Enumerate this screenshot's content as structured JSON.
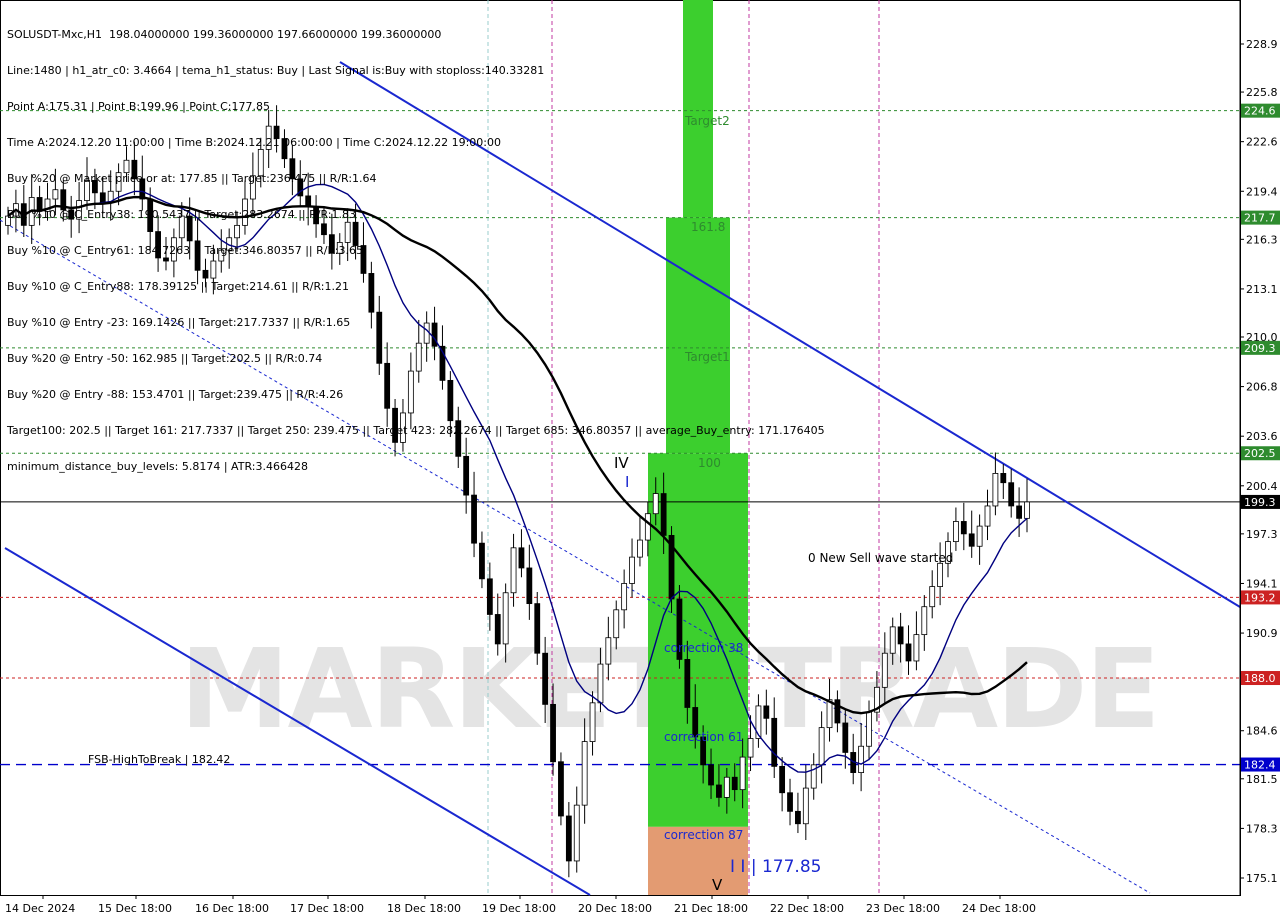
{
  "header": {
    "lines": [
      "SOLUSDT-Mxc,H1  198.04000000 199.36000000 197.66000000 199.36000000",
      "Line:1480 | h1_atr_c0: 3.4664 | tema_h1_status: Buy | Last Signal is:Buy with stoploss:140.33281",
      "Point A:175.31 | Point B:199.96 | Point C:177.85",
      "Time A:2024.12.20 11:00:00 | Time B:2024.12.21 06:00:00 | Time C:2024.12.22 19:00:00",
      "Buy %20 @ Market price or at: 177.85 || Target:236.475 || R/R:1.64",
      "Buy %10 @ C_Entry38: 190.5437 || Target:283.2674 || R/R:1.83",
      "Buy %10 @ C_Entry61: 184.7263 || Target:346.80357 || R/R:3.65",
      "Buy %10 @ C_Entry88: 178.39125 || Target:214.61 || R/R:1.21",
      "Buy %10 @ Entry -23: 169.1426 || Target:217.7337 || R/R:1.65",
      "Buy %20 @ Entry -50: 162.985 || Target:202.5 || R/R:0.74",
      "Buy %20 @ Entry -88: 153.4701 || Target:239.475 || R/R:4.26",
      "Target100: 202.5 || Target 161: 217.7337 || Target 250: 239.475 || Target 423: 282.2674 || Target 685: 346.80357 || average_Buy_entry: 171.176405",
      "minimum_distance_buy_levels: 5.8174 | ATR:3.466428"
    ]
  },
  "chart_data": {
    "type": "candlestick",
    "symbol": "SOLUSDT-Mxc",
    "timeframe": "H1",
    "ohlc_last": {
      "open": 198.04,
      "high": 199.36,
      "low": 197.66,
      "close": 199.36
    },
    "ylim": [
      174.0,
      230.5
    ],
    "y_ticks": [
      228.9,
      225.8,
      222.6,
      219.4,
      216.3,
      213.1,
      210.0,
      206.8,
      203.6,
      200.4,
      197.3,
      194.1,
      190.9,
      187.8,
      184.6,
      181.5,
      178.3,
      175.1
    ],
    "x_labels": [
      "14 Dec 2024",
      "15 Dec 18:00",
      "16 Dec 18:00",
      "17 Dec 18:00",
      "18 Dec 18:00",
      "19 Dec 18:00",
      "20 Dec 18:00",
      "21 Dec 18:00",
      "22 Dec 18:00",
      "23 Dec 18:00",
      "24 Dec 18:00"
    ],
    "price_levels": [
      {
        "value": 224.6,
        "label": "224.6",
        "color": "#2e8b2e",
        "style": "dotted"
      },
      {
        "value": 217.7,
        "label": "217.7",
        "color": "#2e8b2e",
        "style": "dotted"
      },
      {
        "value": 209.3,
        "label": "209.3",
        "color": "#2e8b2e",
        "style": "dotted"
      },
      {
        "value": 202.5,
        "label": "202.5",
        "color": "#2e8b2e",
        "style": "dotted"
      },
      {
        "value": 199.36,
        "label": "199.3",
        "color": "#000000",
        "style": "solid"
      },
      {
        "value": 193.2,
        "label": "193.2",
        "color": "#cc2222",
        "style": "dotted"
      },
      {
        "value": 188.0,
        "label": "188.0",
        "color": "#cc2222",
        "style": "dotted"
      },
      {
        "value": 182.42,
        "label": "182.4",
        "color": "#0000cc",
        "style": "dashed"
      }
    ],
    "zone_labels": [
      "Target2",
      "161.8",
      "Target1",
      "100",
      "correction 38",
      "correction 61",
      "correction 87"
    ],
    "annotations": {
      "wave_iv": "IV",
      "wave_i": "I",
      "wave_v": "V",
      "wave_ii": "I I | 177.85",
      "new_sell_wave": "0 New Sell wave started",
      "fsb_label": "FSB-HighToBreak | 182.42"
    },
    "candles_close": [
      217.8,
      218.6,
      217.2,
      219.0,
      218.1,
      218.9,
      219.5,
      218.2,
      217.6,
      218.8,
      220.1,
      219.3,
      218.7,
      219.4,
      220.6,
      221.4,
      220.2,
      218.9,
      216.8,
      215.1,
      214.9,
      216.4,
      217.8,
      216.2,
      214.3,
      213.8,
      214.9,
      215.6,
      216.4,
      217.2,
      218.9,
      220.4,
      222.1,
      223.6,
      222.8,
      221.5,
      220.2,
      219.1,
      218.4,
      217.3,
      216.6,
      215.4,
      216.1,
      217.4,
      215.9,
      214.1,
      211.6,
      208.3,
      205.4,
      203.2,
      205.1,
      207.8,
      209.6,
      210.9,
      209.4,
      207.2,
      204.6,
      202.3,
      199.8,
      196.7,
      194.4,
      192.1,
      190.2,
      193.5,
      196.4,
      195.1,
      192.8,
      189.6,
      186.3,
      182.6,
      179.1,
      176.2,
      179.8,
      183.9,
      186.4,
      188.9,
      190.6,
      192.4,
      194.1,
      195.8,
      196.9,
      198.6,
      199.9,
      197.2,
      193.1,
      189.2,
      186.1,
      184.2,
      182.4,
      181.1,
      180.3,
      181.6,
      180.8,
      182.9,
      184.1,
      186.2,
      185.4,
      182.3,
      180.6,
      179.4,
      178.6,
      180.9,
      182.4,
      184.8,
      186.6,
      185.1,
      183.2,
      181.9,
      183.6,
      185.8,
      187.4,
      189.6,
      191.3,
      190.2,
      189.1,
      190.8,
      192.6,
      193.9,
      195.4,
      196.8,
      198.1,
      197.3,
      196.5,
      197.8,
      199.1,
      201.2,
      200.6,
      199.1,
      198.3,
      199.36
    ],
    "series": [
      {
        "name": "MA-fast",
        "color": "#000080"
      },
      {
        "name": "MA-slow",
        "color": "#000000"
      }
    ],
    "watermark": "MARKET2TRADE"
  }
}
